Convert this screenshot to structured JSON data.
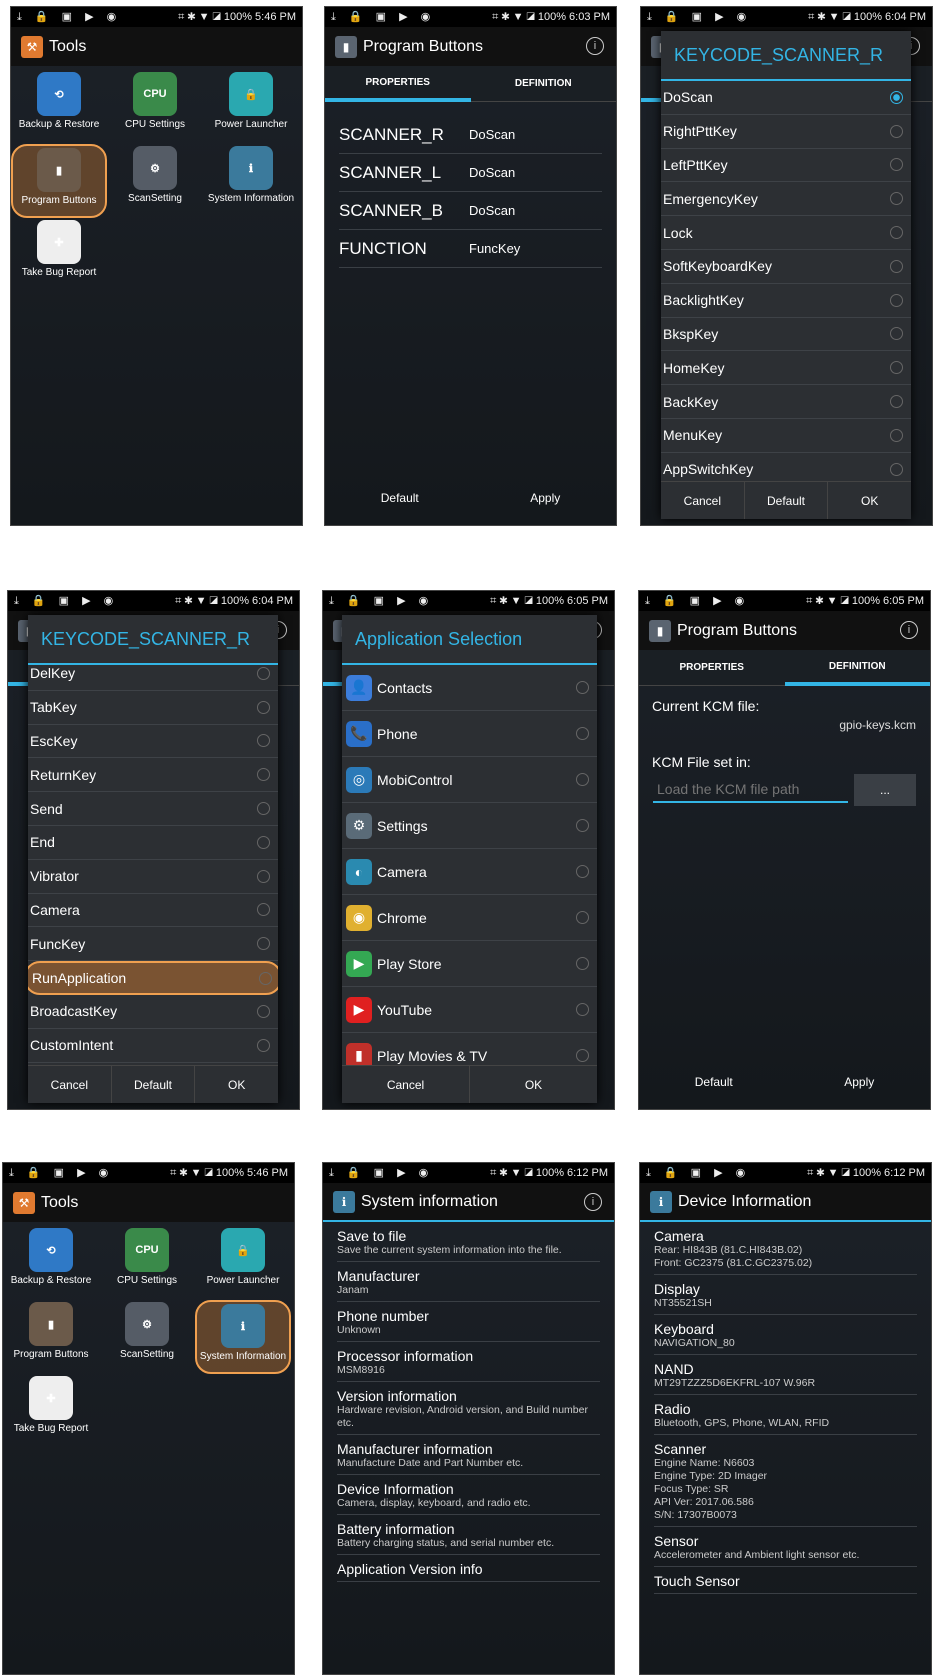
{
  "status": {
    "left_icons": "⤓ 🔒 ▣ ▶ ◉",
    "battery": "100%",
    "times": [
      "5:46 PM",
      "6:03 PM",
      "6:04 PM",
      "6:04 PM",
      "6:05 PM",
      "6:05 PM",
      "5:46 PM",
      "6:12 PM",
      "6:12 PM"
    ]
  },
  "tools": {
    "title": "Tools",
    "apps": [
      {
        "label": "Backup & Restore",
        "icon": "backup-restore-icon",
        "color": "#2f79c6"
      },
      {
        "label": "CPU Settings",
        "icon": "cpu-icon",
        "color": "#3a8a4a"
      },
      {
        "label": "Power Launcher",
        "icon": "power-launcher-icon",
        "color": "#2aa8b0"
      },
      {
        "label": "Program Buttons",
        "icon": "program-buttons-icon",
        "color": "#6b5a4a"
      },
      {
        "label": "ScanSetting",
        "icon": "scan-setting-icon",
        "color": "#555c66"
      },
      {
        "label": "System Information",
        "icon": "system-info-icon",
        "color": "#3b7a9c"
      },
      {
        "label": "Take Bug Report",
        "icon": "bug-report-icon",
        "color": "#eee"
      }
    ]
  },
  "program_buttons": {
    "title": "Program Buttons",
    "tab_properties": "PROPERTIES",
    "tab_definition": "DEFINITION",
    "rows": [
      {
        "key": "SCANNER_R",
        "value": "DoScan"
      },
      {
        "key": "SCANNER_L",
        "value": "DoScan"
      },
      {
        "key": "SCANNER_B",
        "value": "DoScan"
      },
      {
        "key": "FUNCTION",
        "value": "FuncKey"
      }
    ],
    "default": "Default",
    "apply": "Apply"
  },
  "keycode_dialog": {
    "title": "KEYCODE_SCANNER_R",
    "options1": [
      "DoScan",
      "RightPttKey",
      "LeftPttKey",
      "EmergencyKey",
      "Lock",
      "SoftKeyboardKey",
      "BacklightKey",
      "BkspKey",
      "HomeKey",
      "BackKey",
      "MenuKey",
      "AppSwitchKey"
    ],
    "options2": [
      "DelKey",
      "TabKey",
      "EscKey",
      "ReturnKey",
      "Send",
      "End",
      "Vibrator",
      "Camera",
      "FuncKey",
      "RunApplication",
      "BroadcastKey",
      "CustomIntent"
    ],
    "cancel": "Cancel",
    "default": "Default",
    "ok": "OK"
  },
  "app_selection": {
    "title": "Application Selection",
    "apps": [
      "Contacts",
      "Phone",
      "MobiControl",
      "Settings",
      "Camera",
      "Chrome",
      "Play Store",
      "YouTube",
      "Play Movies & TV"
    ],
    "cancel": "Cancel",
    "ok": "OK"
  },
  "definition": {
    "current_label": "Current KCM file:",
    "current_value": "gpio-keys.kcm",
    "set_label": "KCM File set in:",
    "placeholder": "Load the KCM file path",
    "browse": "...",
    "default": "Default",
    "apply": "Apply"
  },
  "system_info": {
    "title": "System information",
    "items": [
      {
        "t": "Save to file",
        "d": "Save the current system information into the file."
      },
      {
        "t": "Manufacturer",
        "d": "Janam"
      },
      {
        "t": "Phone number",
        "d": "Unknown"
      },
      {
        "t": "Processor information",
        "d": "MSM8916"
      },
      {
        "t": "Version information",
        "d": "Hardware revision, Android version, and Build number etc."
      },
      {
        "t": "Manufacturer information",
        "d": "Manufacture Date and Part Number etc."
      },
      {
        "t": "Device Information",
        "d": "Camera, display, keyboard, and radio etc."
      },
      {
        "t": "Battery information",
        "d": "Battery charging status, and serial number etc."
      },
      {
        "t": "Application Version info",
        "d": ""
      }
    ]
  },
  "device_info": {
    "title": "Device Information",
    "items": [
      {
        "t": "Camera",
        "d": "Rear: HI843B (81.C.HI843B.02)\nFront: GC2375 (81.C.GC2375.02)"
      },
      {
        "t": "Display",
        "d": "NT35521SH"
      },
      {
        "t": "Keyboard",
        "d": "NAVIGATION_80"
      },
      {
        "t": "NAND",
        "d": "MT29TZZZ5D6EKFRL-107 W.96R"
      },
      {
        "t": "Radio",
        "d": "Bluetooth, GPS, Phone, WLAN, RFID"
      },
      {
        "t": "Scanner",
        "d": "Engine Name: N6603\nEngine Type: 2D Imager\nFocus Type: SR\nAPI Ver: 2017.06.586\nS/N: 17307B0073"
      },
      {
        "t": "Sensor",
        "d": "Accelerometer and Ambient light sensor etc."
      },
      {
        "t": "Touch Sensor",
        "d": ""
      }
    ]
  }
}
